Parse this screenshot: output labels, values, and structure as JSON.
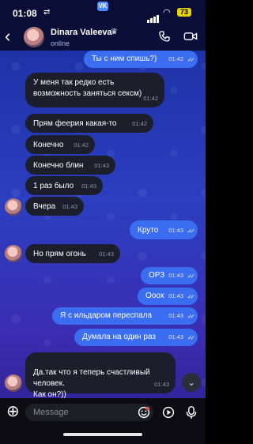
{
  "status_bar": {
    "time": "01:08",
    "battery": "73",
    "app_badge": "VK"
  },
  "header": {
    "contact_name": "Dinara Valeeva",
    "contact_status": "online"
  },
  "messages": [
    {
      "dir": "out",
      "text": "Ты с ним спишь?)",
      "time": "01:42"
    },
    {
      "dir": "in",
      "text": "У меня так редко есть возможность заняться сексм)",
      "time": "01:42"
    },
    {
      "dir": "in",
      "text": "Прям феерия какая-то",
      "time": "01:42"
    },
    {
      "dir": "in",
      "text": "Конечно",
      "time": "01:42"
    },
    {
      "dir": "in",
      "text": "Конечно блин",
      "time": "01:43"
    },
    {
      "dir": "in",
      "text": "1 раз было",
      "time": "01:43"
    },
    {
      "dir": "in",
      "text": "Вчера",
      "time": "01:43"
    },
    {
      "dir": "out",
      "text": "Круто",
      "time": "01:43"
    },
    {
      "dir": "in",
      "text": "Но прям огонь",
      "time": "01:43"
    },
    {
      "dir": "out",
      "text": "ОРЗ",
      "time": "01:43"
    },
    {
      "dir": "out",
      "text": "Ооох",
      "time": "01:43"
    },
    {
      "dir": "out",
      "text": "Я с ильдаром переспала",
      "time": "01:43"
    },
    {
      "dir": "out",
      "text": "Думала на один раз",
      "time": "01:43"
    },
    {
      "dir": "in",
      "text": "Да.так что я теперь счастливый человек.\nКак он?))",
      "time": "01:43"
    }
  ],
  "composer": {
    "placeholder": "Message"
  },
  "colors": {
    "outgoing_bubble": "#3b6df0",
    "incoming_bubble": "#1c1f2b",
    "battery": "#e7d20b"
  },
  "icons": [
    "back-icon",
    "call-icon",
    "video-icon",
    "plus-icon",
    "emoji-icon",
    "play-icon",
    "mic-icon",
    "chevron-down-icon",
    "crown-icon"
  ]
}
